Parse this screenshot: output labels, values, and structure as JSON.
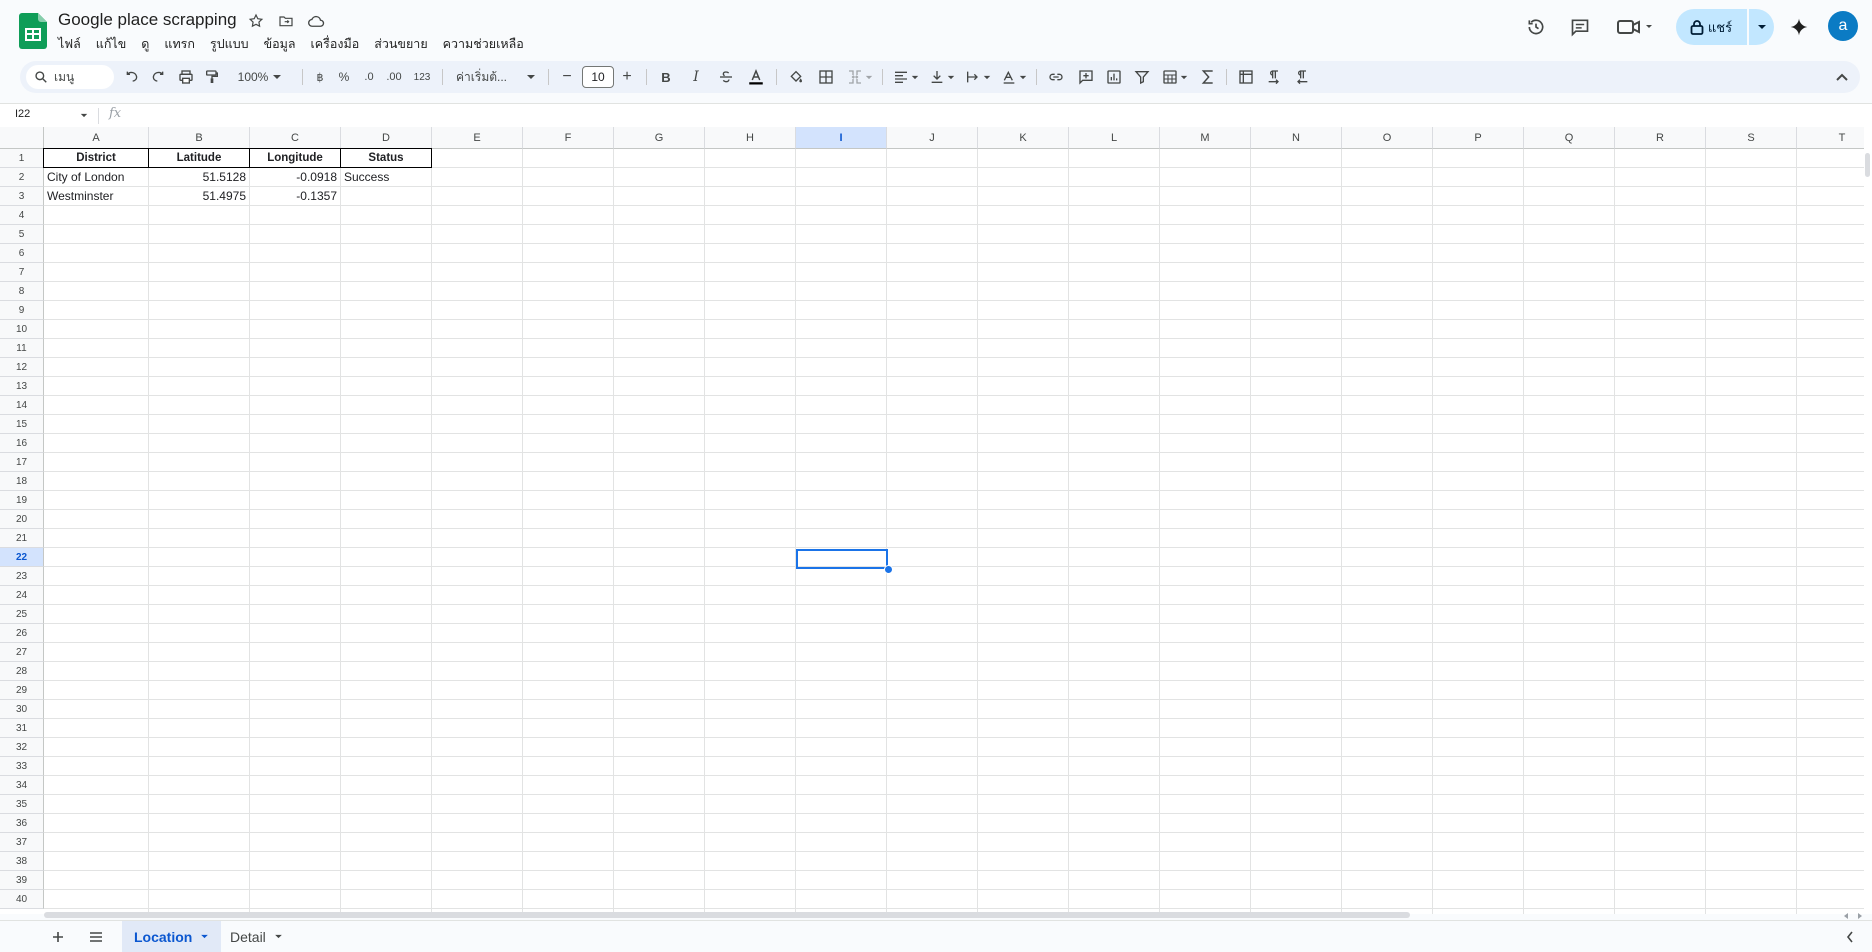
{
  "app": {
    "doc_title": "Google place scrapping",
    "menu": [
      "ไฟล์",
      "แก้ไข",
      "ดู",
      "แทรก",
      "รูปแบบ",
      "ข้อมูล",
      "เครื่องมือ",
      "ส่วนขยาย",
      "ความช่วยเหลือ"
    ],
    "share_label": "แชร์",
    "avatar_letter": "a",
    "accent_color": "#0b57d0"
  },
  "toolbar": {
    "search_label": "เมนู",
    "zoom": "100%",
    "percent": "%",
    "decrease_decimal": ".0",
    "increase_decimal": ".00",
    "number_format": "123",
    "font": "ค่าเริ่มต้...",
    "font_size": "10",
    "bold": "B",
    "italic": "I",
    "minus": "−",
    "plus": "+"
  },
  "formula_bar": {
    "name_box": "I22",
    "fx": "fx",
    "value": ""
  },
  "sheet": {
    "columns": [
      "A",
      "B",
      "C",
      "D",
      "E",
      "F",
      "G",
      "H",
      "I",
      "J",
      "K",
      "L",
      "M",
      "N",
      "O",
      "P",
      "Q",
      "R",
      "S",
      "T"
    ],
    "selected_column": "I",
    "selected_row": "22",
    "rows": [
      "1",
      "2",
      "3",
      "4",
      "5",
      "6",
      "7",
      "8",
      "9",
      "10",
      "11",
      "12",
      "13",
      "14",
      "15",
      "16",
      "17",
      "18",
      "19",
      "20",
      "21",
      "22",
      "23",
      "24",
      "25",
      "26",
      "27",
      "28",
      "29",
      "30",
      "31",
      "32",
      "33",
      "34",
      "35",
      "36",
      "37",
      "38",
      "39",
      "40"
    ],
    "headers": [
      "District",
      "Latitude",
      "Longitude",
      "Status"
    ],
    "data": [
      [
        "City of London",
        "51.5128",
        "-0.0918",
        "Success"
      ],
      [
        "Westminster",
        "51.4975",
        "-0.1357",
        ""
      ]
    ]
  },
  "sheet_tabs": [
    {
      "label": "Location",
      "active": true
    },
    {
      "label": "Detail",
      "active": false
    }
  ]
}
